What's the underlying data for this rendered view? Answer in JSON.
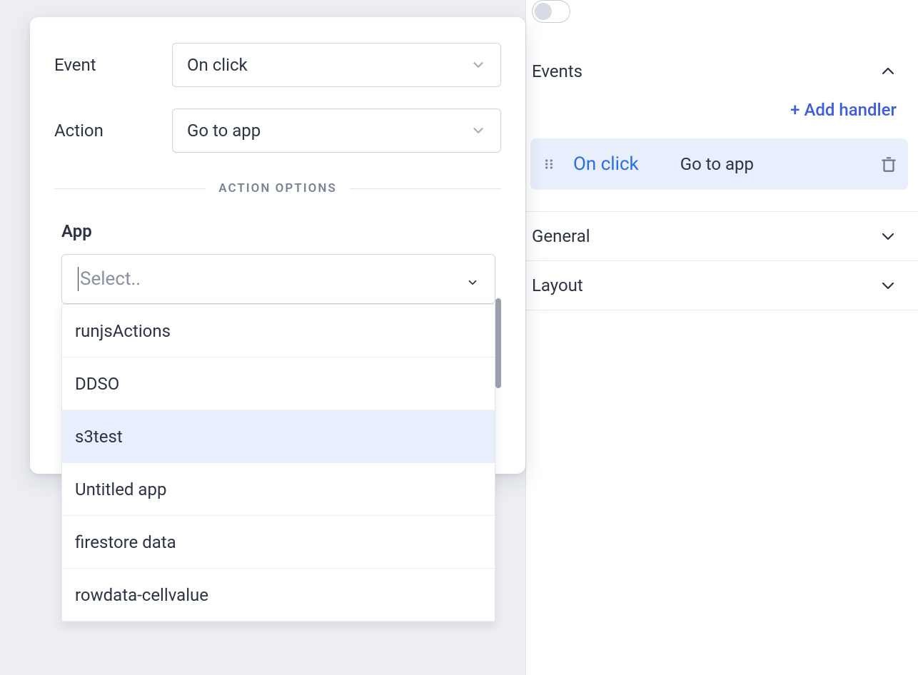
{
  "panel": {
    "event_label": "Event",
    "event_value": "On click",
    "action_label": "Action",
    "action_value": "Go to app",
    "options_heading": "ACTION OPTIONS",
    "app_label": "App",
    "app_placeholder": "Select..",
    "app_options": [
      {
        "label": "runjsActions",
        "highlighted": false
      },
      {
        "label": "DDSO",
        "highlighted": false
      },
      {
        "label": "s3test",
        "highlighted": true
      },
      {
        "label": "Untitled app",
        "highlighted": false
      },
      {
        "label": "firestore data",
        "highlighted": false
      },
      {
        "label": "rowdata-cellvalue",
        "highlighted": false
      }
    ]
  },
  "sidebar": {
    "sections": {
      "events": {
        "title": "Events",
        "expanded": true
      },
      "general": {
        "title": "General",
        "expanded": false
      },
      "layout": {
        "title": "Layout",
        "expanded": false
      }
    },
    "add_handler_label": "+ Add handler",
    "handler": {
      "event": "On click",
      "action": "Go to app"
    },
    "toggle_state": false
  }
}
